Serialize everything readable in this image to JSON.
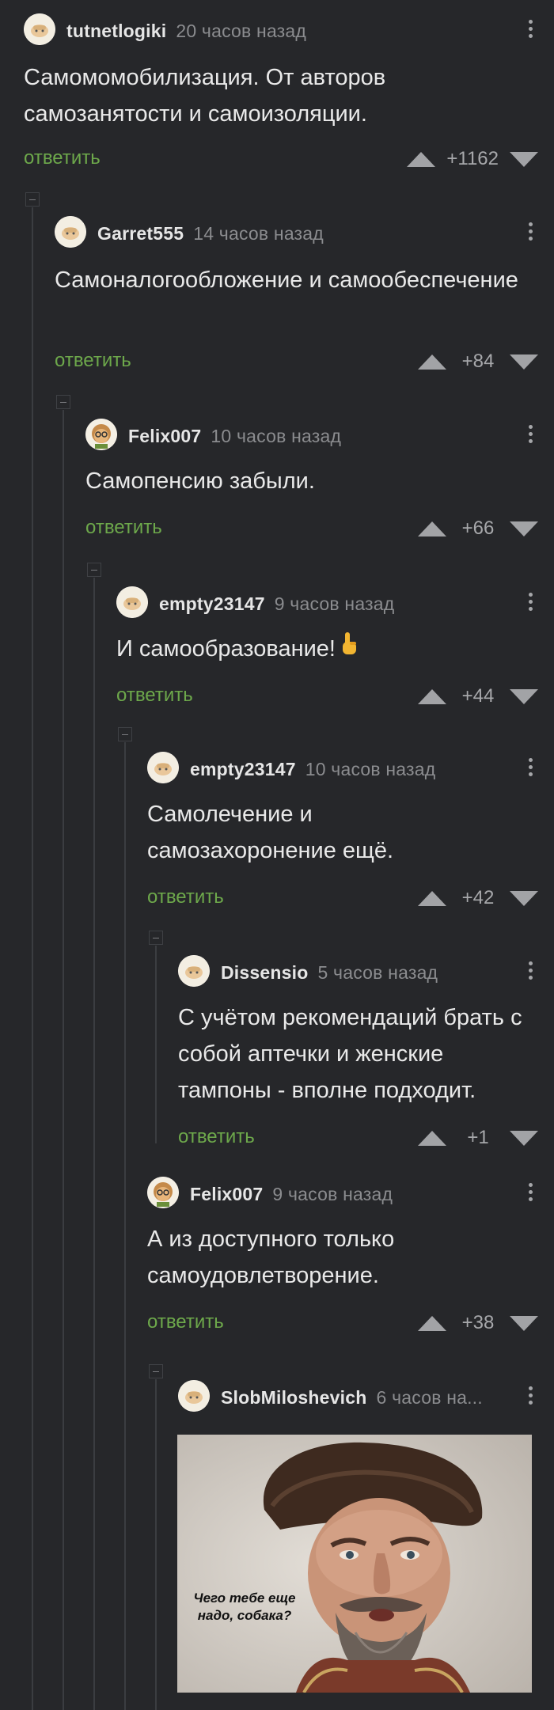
{
  "comments": [
    {
      "user": "tutnetlogiki",
      "time": "20 часов назад",
      "text": "Самомомобилизация. От авторов самозанятости и самоизоляции.",
      "reply": "ответить",
      "score": "+1162"
    },
    {
      "user": "Garret555",
      "time": "14 часов назад",
      "text": "Самоналогообложение и самообеспечение",
      "reply": "ответить",
      "score": "+84"
    },
    {
      "user": "Felix007",
      "time": "10 часов назад",
      "text": "Самопенсию забыли.",
      "reply": "ответить",
      "score": "+66"
    },
    {
      "user": "empty23147",
      "time": "9 часов назад",
      "text": "И самообразование!",
      "reply": "ответить",
      "score": "+44"
    },
    {
      "user": "empty23147",
      "time": "10 часов назад",
      "text": "Самолечение и самозахоронение ещё.",
      "reply": "ответить",
      "score": "+42"
    },
    {
      "user": "Dissensio",
      "time": "5 часов назад",
      "text": "С учётом рекомендаций брать с собой аптечки и женские тампоны - вполне подходит.",
      "reply": "ответить",
      "score": "+1"
    },
    {
      "user": "Felix007",
      "time": "9 часов назад",
      "text": "А из доступного только самоудовлетворение.",
      "reply": "ответить",
      "score": "+38"
    },
    {
      "user": "SlobMiloshevich",
      "time": "6 часов на...",
      "text": "",
      "reply": "",
      "score": ""
    }
  ],
  "meme": {
    "caption": "Чего тебе еще надо, собака?"
  },
  "icons": {
    "vote_up": "triangle-up-icon",
    "vote_down": "triangle-down-icon",
    "more": "vertical-dots-icon",
    "collapse": "collapse-minus-icon",
    "emoji": "pointing-up-hand-icon"
  },
  "colors": {
    "background": "#26272a",
    "reply": "#6da84b",
    "username": "#e6e6e6",
    "meta": "#8b8c8f"
  }
}
